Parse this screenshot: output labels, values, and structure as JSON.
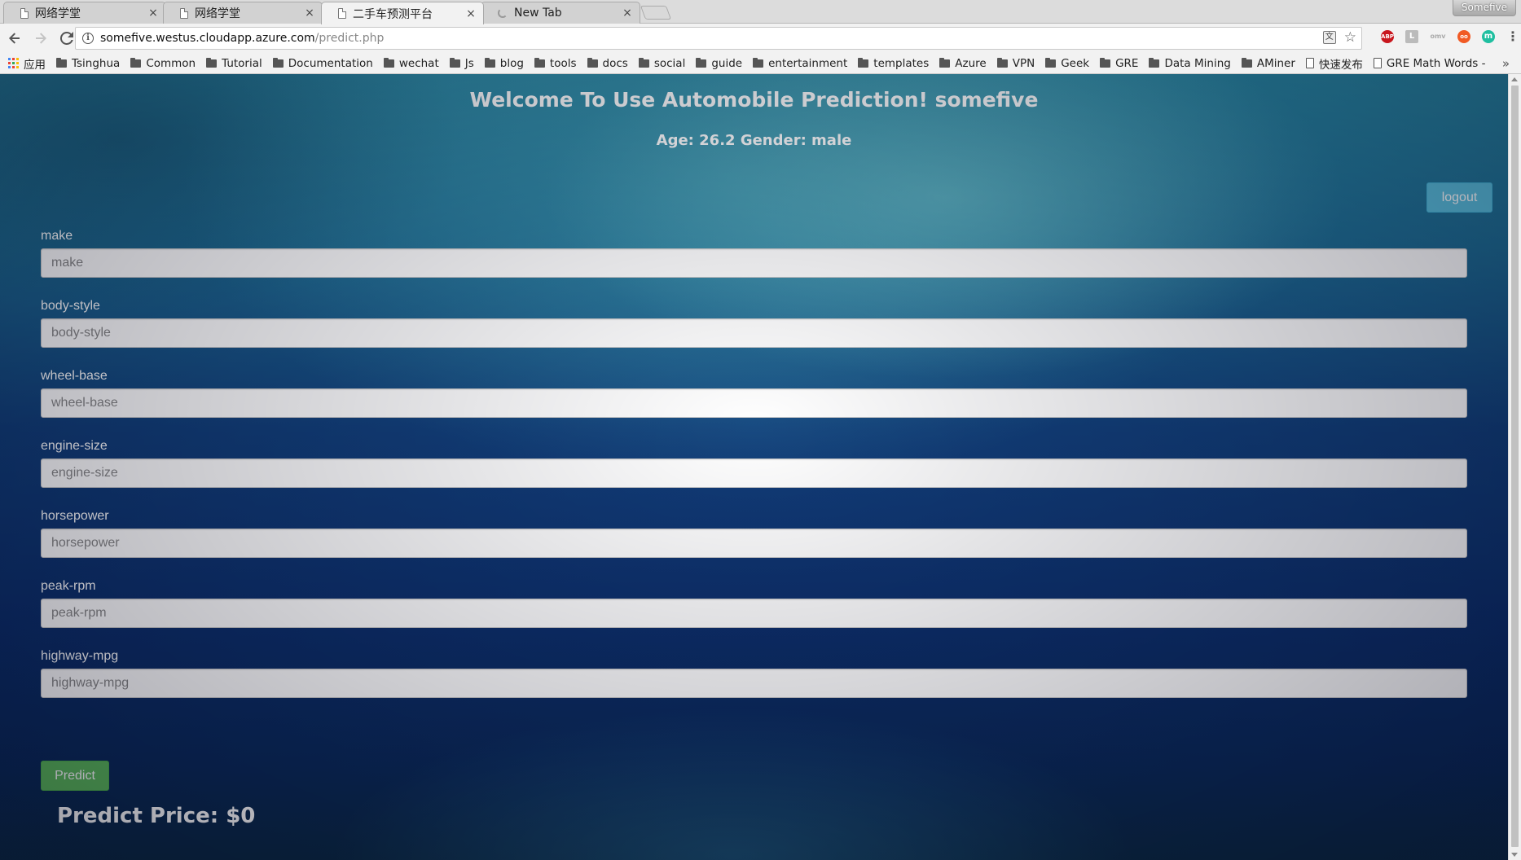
{
  "browser": {
    "tabs": [
      {
        "title": "网络学堂"
      },
      {
        "title": "网络学堂"
      },
      {
        "title": "二手车预测平台"
      },
      {
        "title": "New Tab"
      }
    ],
    "tab_close_glyph": "×",
    "profile_name": "Somefive",
    "url_host": "somefive.westus.cloudapp.azure.com",
    "url_path": "/predict.php",
    "extensions": [
      "ABP",
      "L",
      "omv",
      "oo",
      "m"
    ],
    "bookmarks": [
      {
        "label": "应用",
        "icon": "apps-icon"
      },
      {
        "label": "Tsinghua",
        "icon": "folder-icon"
      },
      {
        "label": "Common",
        "icon": "folder-icon"
      },
      {
        "label": "Tutorial",
        "icon": "folder-icon"
      },
      {
        "label": "Documentation",
        "icon": "folder-icon"
      },
      {
        "label": "wechat",
        "icon": "folder-icon"
      },
      {
        "label": "Js",
        "icon": "folder-icon"
      },
      {
        "label": "blog",
        "icon": "folder-icon"
      },
      {
        "label": "tools",
        "icon": "folder-icon"
      },
      {
        "label": "docs",
        "icon": "folder-icon"
      },
      {
        "label": "social",
        "icon": "folder-icon"
      },
      {
        "label": "guide",
        "icon": "folder-icon"
      },
      {
        "label": "entertainment",
        "icon": "folder-icon"
      },
      {
        "label": "templates",
        "icon": "folder-icon"
      },
      {
        "label": "Azure",
        "icon": "folder-icon"
      },
      {
        "label": "VPN",
        "icon": "folder-icon"
      },
      {
        "label": "Geek",
        "icon": "folder-icon"
      },
      {
        "label": "GRE",
        "icon": "folder-icon"
      },
      {
        "label": "Data Mining",
        "icon": "folder-icon"
      },
      {
        "label": "AMiner",
        "icon": "folder-icon"
      },
      {
        "label": "快速发布",
        "icon": "doc-icon"
      },
      {
        "label": "GRE Math Words -",
        "icon": "doc-icon"
      }
    ],
    "bookmarks_overflow": "»"
  },
  "page": {
    "welcome": "Welcome To Use Automobile Prediction! somefive",
    "user_info": "Age: 26.2 Gender: male",
    "logout_label": "logout",
    "fields": [
      {
        "label": "make",
        "placeholder": "make",
        "value": ""
      },
      {
        "label": "body-style",
        "placeholder": "body-style",
        "value": ""
      },
      {
        "label": "wheel-base",
        "placeholder": "wheel-base",
        "value": ""
      },
      {
        "label": "engine-size",
        "placeholder": "engine-size",
        "value": ""
      },
      {
        "label": "horsepower",
        "placeholder": "horsepower",
        "value": ""
      },
      {
        "label": "peak-rpm",
        "placeholder": "peak-rpm",
        "value": ""
      },
      {
        "label": "highway-mpg",
        "placeholder": "highway-mpg",
        "value": ""
      }
    ],
    "predict_label": "Predict",
    "result": "Predict Price: $0"
  },
  "colors": {
    "logout_button": "#5bc0de",
    "predict_button": "#5cb85c"
  }
}
